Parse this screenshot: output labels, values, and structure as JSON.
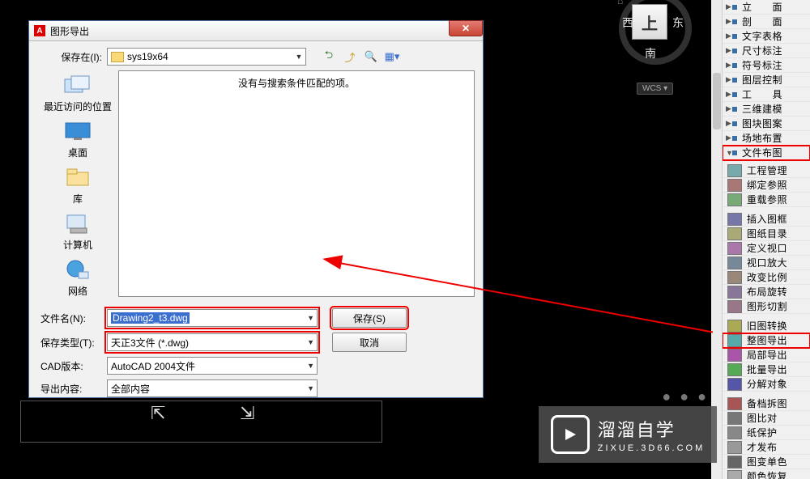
{
  "dialog": {
    "title": "图形导出",
    "saveInLabel": "保存在(I):",
    "pathValue": "sys19x64",
    "emptyMessage": "没有与搜索条件匹配的项。",
    "fileNameLabel": "文件名(N):",
    "fileNameValue": "Drawing2_t3.dwg",
    "saveTypeLabel": "保存类型(T):",
    "saveTypeValue": "天正3文件 (*.dwg)",
    "cadVersionLabel": "CAD版本:",
    "cadVersionValue": "AutoCAD 2004文件",
    "exportContentLabel": "导出内容:",
    "exportContentValue": "全部内容",
    "saveButton": "保存(S)",
    "cancelButton": "取消"
  },
  "places": {
    "recent": "最近访问的位置",
    "desktop": "桌面",
    "libraries": "库",
    "computer": "计算机",
    "network": "网络"
  },
  "viewcube": {
    "top": "上",
    "west": "西",
    "east": "东",
    "south": "南",
    "wcs": "WCS"
  },
  "panel_top": [
    "立　　面",
    "剖　　面",
    "文字表格",
    "尺寸标注",
    "符号标注",
    "图层控制",
    "工　　具",
    "三维建模",
    "图块图案",
    "场地布置",
    "文件布图"
  ],
  "panel_items": [
    "工程管理",
    "绑定参照",
    "重载参照",
    "插入图框",
    "图纸目录",
    "定义视口",
    "视口放大",
    "改变比例",
    "布局旋转",
    "图形切割",
    "旧图转换",
    "整图导出",
    "局部导出",
    "批量导出",
    "分解对象",
    "备档拆图",
    "图比对",
    "纸保护",
    "才发布",
    "图变单色",
    "颜色恢复"
  ],
  "watermark": {
    "brand": "溜溜自学",
    "url": "ZIXUE.3D66.COM"
  }
}
